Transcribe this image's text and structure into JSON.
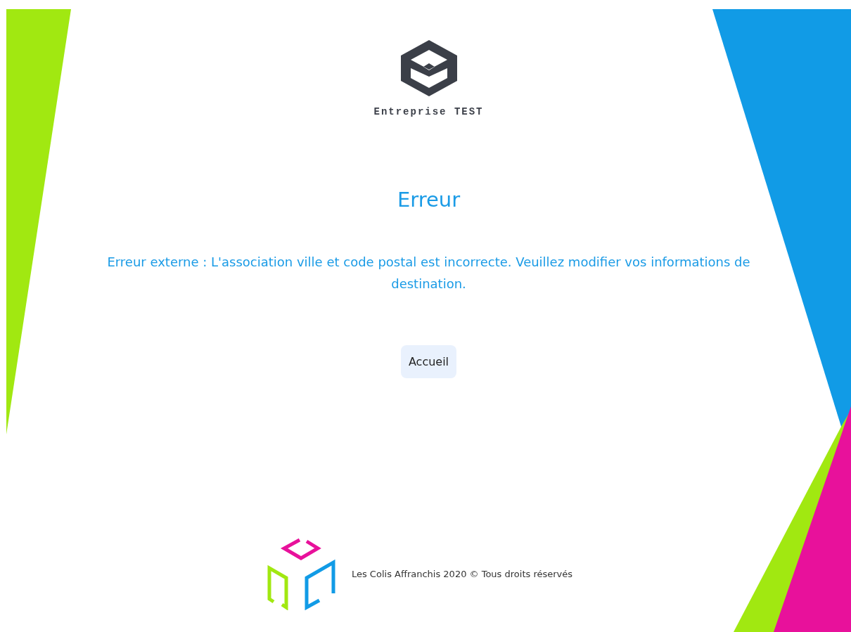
{
  "brand": {
    "name": "Entreprise TEST"
  },
  "error": {
    "title": "Erreur",
    "message": "Erreur externe : L'association ville et code postal est incorrecte. Veuillez modifier vos informations de destination."
  },
  "buttons": [
    {
      "label": "Accueil"
    }
  ],
  "footer": {
    "text": "Les Colis Affranchis 2020 © Tous droits réservés"
  }
}
